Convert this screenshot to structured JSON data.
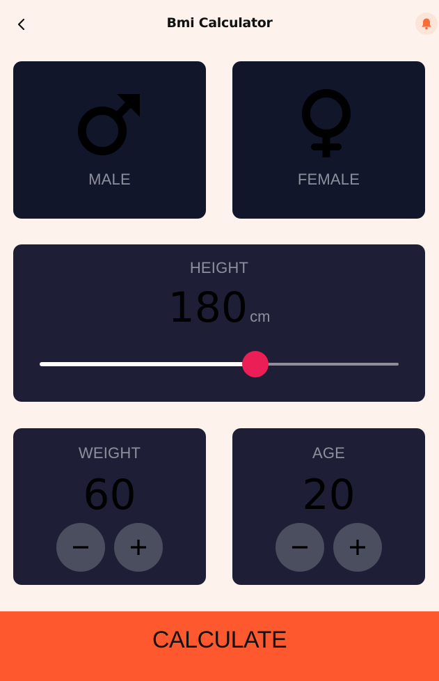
{
  "appbar": {
    "title": "Bmi Calculator",
    "back_icon": "chevron-left-icon",
    "notification_icon": "bell-icon"
  },
  "gender": {
    "male": {
      "label": "MALE",
      "icon": "male-symbol-icon"
    },
    "female": {
      "label": "FEMALE",
      "icon": "female-symbol-icon"
    }
  },
  "height": {
    "label": "HEIGHT",
    "value": "180",
    "unit": "cm",
    "slider_fraction": 0.6
  },
  "weight": {
    "label": "WEIGHT",
    "value": "60",
    "minus_icon": "minus-icon",
    "plus_icon": "plus-icon"
  },
  "age": {
    "label": "AGE",
    "value": "20",
    "minus_icon": "minus-icon",
    "plus_icon": "plus-icon"
  },
  "calculate_label": "CALCULATE",
  "colors": {
    "background": "#fdf3ec",
    "gender_card": "#12162b",
    "panel": "#1e1f36",
    "slider_thumb": "#eb1f55",
    "round_button": "#4b4e5e",
    "accent": "#fe582f",
    "bell": "#ff6a3a"
  }
}
